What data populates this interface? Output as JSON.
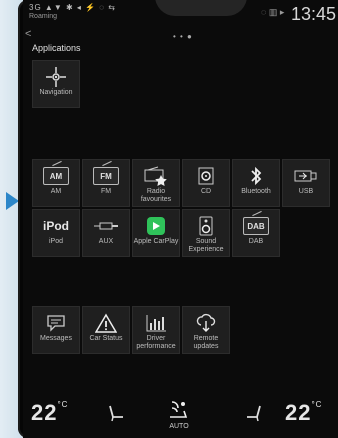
{
  "status": {
    "signal_text": "3G ▲▼ ✱ ◂ ⚡ ◌ ⇆",
    "roaming": "Roaming",
    "sys_text": "◌ ▥ ▸",
    "time": "13:45"
  },
  "nav": {
    "back": "<",
    "pager": "• • ●"
  },
  "page_title": "Applications",
  "apps_row1": [
    {
      "label": "Navigation",
      "icon": "compass-icon"
    }
  ],
  "apps_row2": [
    {
      "label": "AM",
      "icon": "am-radio-icon",
      "icon_text": "AM"
    },
    {
      "label": "FM",
      "icon": "fm-radio-icon",
      "icon_text": "FM"
    },
    {
      "label": "Radio favourites",
      "icon": "radio-star-icon"
    },
    {
      "label": "CD",
      "icon": "cd-icon"
    },
    {
      "label": "Bluetooth",
      "icon": "bluetooth-icon"
    },
    {
      "label": "USB",
      "icon": "usb-icon"
    }
  ],
  "apps_row3": [
    {
      "label": "iPod",
      "icon": "ipod-icon",
      "icon_text": "iPod"
    },
    {
      "label": "AUX",
      "icon": "aux-icon"
    },
    {
      "label": "Apple CarPlay",
      "icon": "carplay-icon"
    },
    {
      "label": "Sound Experience",
      "icon": "speaker-icon"
    },
    {
      "label": "DAB",
      "icon": "dab-icon",
      "icon_text": "DAB"
    }
  ],
  "apps_row4": [
    {
      "label": "Messages",
      "icon": "message-icon"
    },
    {
      "label": "Car Status",
      "icon": "warning-icon"
    },
    {
      "label": "Driver performance",
      "icon": "bar-chart-icon"
    },
    {
      "label": "Remote updates",
      "icon": "cloud-download-icon"
    }
  ],
  "climate": {
    "left_temp": "22",
    "right_temp": "22",
    "unit": "°C",
    "fan_mode": "AUTO"
  },
  "colors": {
    "accent_arrow": "#2c86c9",
    "carplay_green": "#2fc25a"
  }
}
